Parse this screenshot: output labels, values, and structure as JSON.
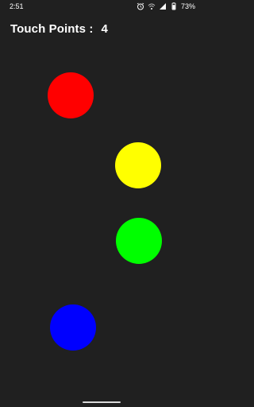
{
  "status_bar": {
    "time": "2:51",
    "battery_percent": "73%",
    "icons": [
      "alarm-icon",
      "wifi-icon",
      "signal-icon",
      "battery-icon"
    ]
  },
  "header": {
    "label": "Touch Points :",
    "count": "4"
  },
  "touch_points": [
    {
      "color": "#ff0000",
      "name": "red"
    },
    {
      "color": "#ffff00",
      "name": "yellow"
    },
    {
      "color": "#00ff00",
      "name": "green"
    },
    {
      "color": "#0000ff",
      "name": "blue"
    }
  ],
  "colors": {
    "background": "#202020",
    "text": "#ffffff"
  }
}
